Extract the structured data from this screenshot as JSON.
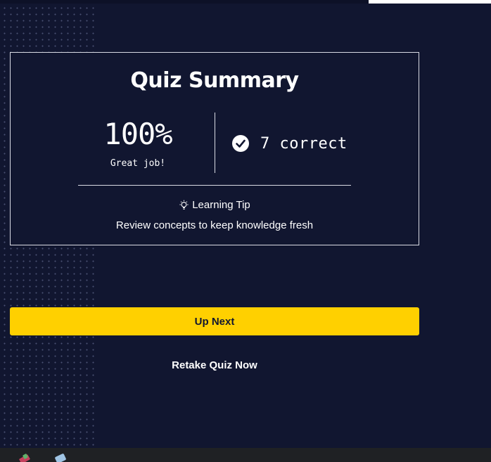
{
  "summary": {
    "title": "Quiz Summary",
    "score_percent": "100%",
    "score_message": "Great job!",
    "correct_text": "7 correct",
    "tip_heading": "Learning Tip",
    "tip_text": "Review concepts to keep knowledge fresh"
  },
  "actions": {
    "up_next_label": "Up Next",
    "retake_label": "Retake Quiz Now"
  },
  "icons": {
    "check": "check-circle-icon",
    "tip": "lightbulb-icon",
    "taskbar": [
      "paint-app-icon",
      "eraser-app-icon"
    ]
  },
  "colors": {
    "background": "#111630",
    "accent": "#ffd000",
    "text": "#ffffff",
    "border": "#d9dbe4"
  }
}
